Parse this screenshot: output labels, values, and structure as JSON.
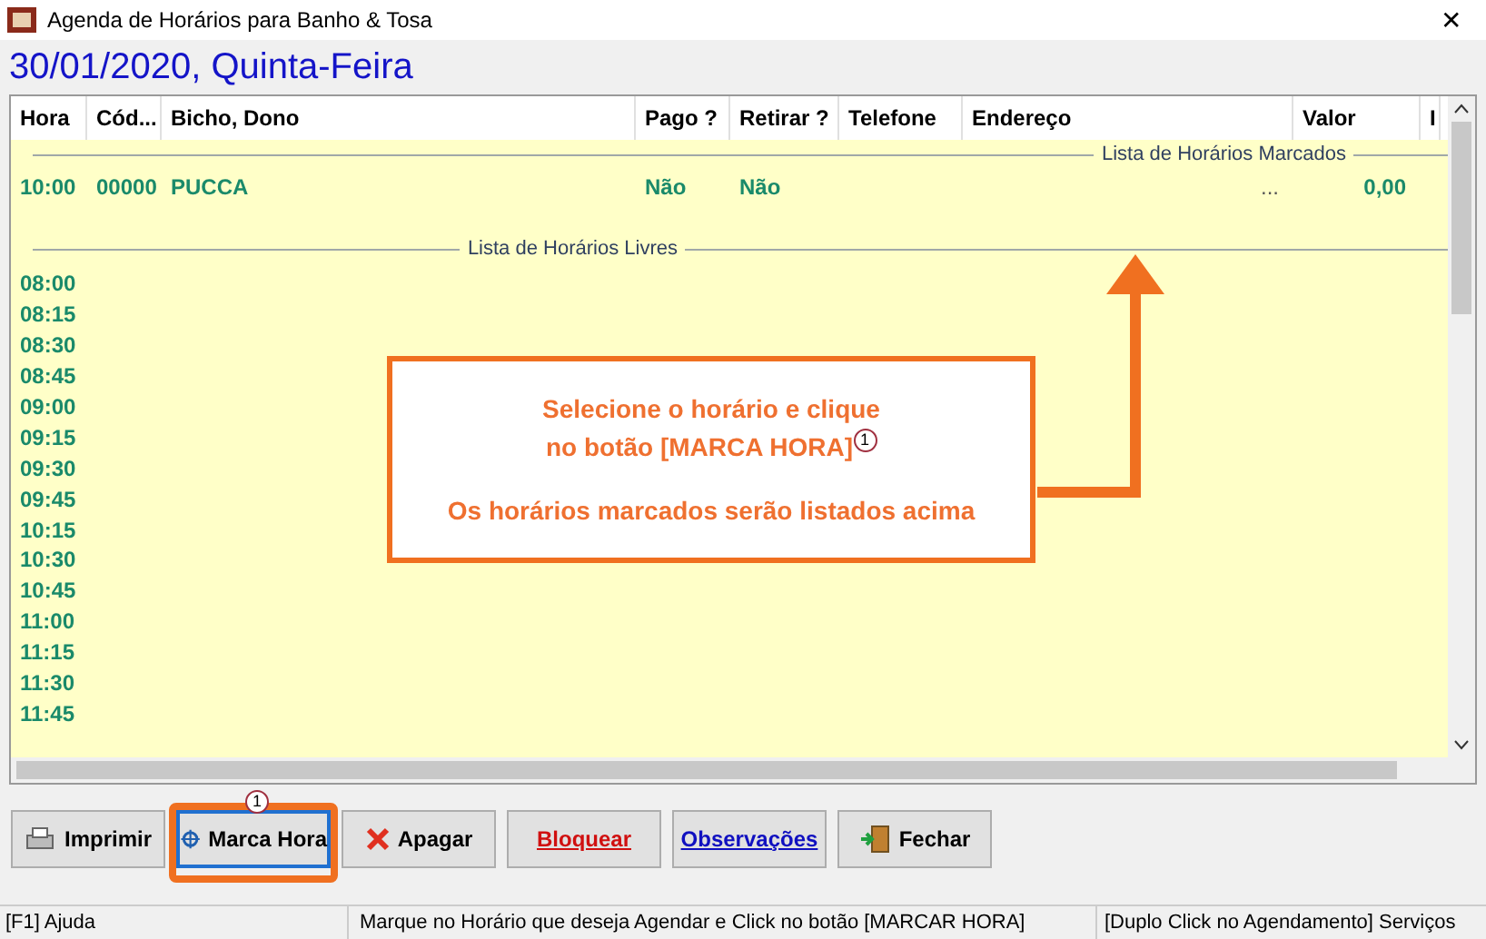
{
  "window": {
    "title": "Agenda de Horários para Banho & Tosa",
    "close": "✕"
  },
  "date_heading": "30/01/2020, Quinta-Feira",
  "table": {
    "columns": [
      "Hora",
      "Cód...",
      "Bicho, Dono",
      "Pago ?",
      "Retirar ?",
      "Telefone",
      "Endereço",
      "Valor",
      "I"
    ],
    "booked_title": "Lista de Horários Marcados",
    "booked": [
      {
        "hora": "10:00",
        "codigo": "00000",
        "bicho": "PUCCA",
        "pago": "Não",
        "retirar": "Não",
        "endereco": "...",
        "valor": "0,00"
      }
    ],
    "free_title": "Lista de Horários Livres",
    "free": [
      {
        "hora": "08:00"
      },
      {
        "hora": "08:15"
      },
      {
        "hora": "08:30"
      },
      {
        "hora": "08:45"
      },
      {
        "hora": "09:00"
      },
      {
        "hora": "09:15"
      },
      {
        "hora": "09:30"
      },
      {
        "hora": "09:45"
      },
      {
        "hora": "10:15"
      },
      {
        "hora": "10:30"
      },
      {
        "hora": "10:45"
      },
      {
        "hora": "11:00"
      },
      {
        "hora": "11:15"
      },
      {
        "hora": "11:30"
      },
      {
        "hora": "11:45"
      }
    ]
  },
  "callout": {
    "line1": "Selecione o horário e clique",
    "line2": "no botão [MARCA HORA]",
    "badge": "1",
    "line3": "Os horários marcados serão listados acima"
  },
  "buttons": [
    {
      "label": "Imprimir",
      "color": "#000000",
      "highlighted": false
    },
    {
      "label": "Marca Hora",
      "color": "#000000",
      "highlighted": true,
      "badge": "1"
    },
    {
      "label": "Apagar",
      "color": "#000000",
      "highlighted": false
    },
    {
      "label": "Bloquear",
      "color": "#d01010",
      "highlighted": false
    },
    {
      "label": "Observações",
      "color": "#1010c0",
      "highlighted": false
    },
    {
      "label": "Fechar",
      "color": "#000000",
      "highlighted": false
    }
  ],
  "status_bar": [
    "[F1] Ajuda",
    "Marque no Horário que deseja Agendar e Click no botão [MARCAR HORA]",
    "[Duplo Click no Agendamento] Serviços"
  ]
}
